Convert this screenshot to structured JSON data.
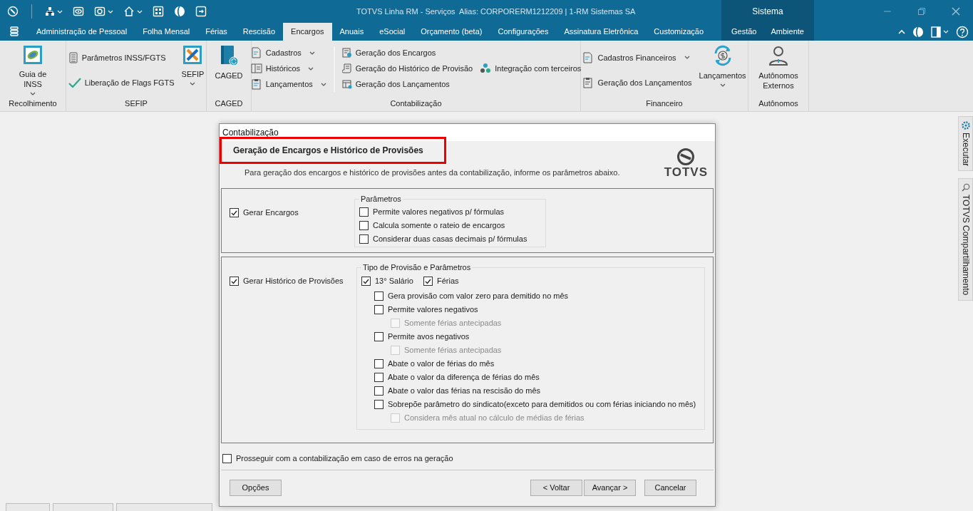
{
  "window": {
    "title": "TOTVS Linha RM - Serviços  Alias: CORPORERM1212209 | 1-RM Sistemas SA"
  },
  "ribbon_tabs": [
    {
      "label": "Administração de Pessoal",
      "selected": false
    },
    {
      "label": "Folha Mensal",
      "selected": false
    },
    {
      "label": "Férias",
      "selected": false
    },
    {
      "label": "Rescisão",
      "selected": false
    },
    {
      "label": "Encargos",
      "selected": true
    },
    {
      "label": "Anuais",
      "selected": false
    },
    {
      "label": "eSocial",
      "selected": false
    },
    {
      "label": "Orçamento (beta)",
      "selected": false
    },
    {
      "label": "Configurações",
      "selected": false
    },
    {
      "label": "Assinatura Eletrônica",
      "selected": false
    },
    {
      "label": "Customização",
      "selected": false
    }
  ],
  "context_group": {
    "label": "Sistema",
    "tabs": [
      {
        "label": "Gestão",
        "selected": false
      },
      {
        "label": "Ambiente",
        "selected": false
      }
    ]
  },
  "ribbon_groups": [
    {
      "label": "Recolhimento",
      "items": [
        {
          "kind": "large",
          "label": "Guia de INSS",
          "dropdown": true
        }
      ]
    },
    {
      "label": "SEFIP",
      "items": [
        {
          "kind": "stack",
          "items": [
            {
              "label": "Parâmetros INSS/FGTS",
              "dropdown": false
            },
            {
              "label": "Liberação de Flags FGTS",
              "dropdown": false
            }
          ]
        },
        {
          "kind": "large",
          "label": "SEFIP",
          "dropdown": true
        }
      ]
    },
    {
      "label": "CAGED",
      "items": [
        {
          "kind": "large",
          "label": "CAGED",
          "dropdown": false
        }
      ]
    },
    {
      "label": "Contabilização",
      "items": [
        {
          "kind": "stack",
          "separator": true,
          "items": [
            {
              "label": "Cadastros",
              "dropdown": true
            },
            {
              "label": "Históricos",
              "dropdown": true
            },
            {
              "label": "Lançamentos",
              "dropdown": true
            }
          ]
        },
        {
          "kind": "stack",
          "items": [
            {
              "label": "Geração dos Encargos",
              "dropdown": false
            },
            {
              "label": "Geração do Histórico de Provisão",
              "dropdown": false
            },
            {
              "label": "Geração dos Lançamentos",
              "dropdown": false
            }
          ]
        },
        {
          "kind": "stack",
          "items": [
            {
              "label": "Integração com terceiros",
              "dropdown": false
            }
          ]
        }
      ]
    },
    {
      "label": "Financeiro",
      "items": [
        {
          "kind": "stack",
          "items": [
            {
              "label": "Cadastros Financeiros",
              "dropdown": true
            },
            {
              "label": "Geração dos Lançamentos",
              "dropdown": false
            }
          ]
        },
        {
          "kind": "large",
          "label": "Lançamentos",
          "dropdown": true
        }
      ]
    },
    {
      "label": "Autônomos",
      "items": [
        {
          "kind": "large",
          "label": "Autônomos Externos",
          "dropdown": false
        }
      ]
    }
  ],
  "side_tabs": [
    "Executar",
    "TOTVS Compartilhamento"
  ],
  "dialog": {
    "title": "Contabilização",
    "heading": "Geração de Encargos e Histórico de Provisões",
    "heading_highlighted": true,
    "description": "Para geração dos encargos e histórico de provisões antes da contabilização, informe os parâmetros abaixo.",
    "logo": "TOTVS",
    "sections": [
      {
        "checkbox": {
          "label": "Gerar Encargos",
          "checked": true
        },
        "group": {
          "title": "Parâmetros",
          "options": [
            {
              "label": "Permite valores negativos p/ fórmulas",
              "checked": false,
              "disabled": false
            },
            {
              "label": "Calcula somente o rateio de encargos",
              "checked": false,
              "disabled": false
            },
            {
              "label": "Considerar duas casas decimais p/ fórmulas",
              "checked": false,
              "disabled": false
            }
          ]
        }
      },
      {
        "checkbox": {
          "label": "Gerar Histórico de Provisões",
          "checked": true
        },
        "group": {
          "title": "Tipo de Provisão e Parâmetros",
          "types": [
            {
              "label": "13° Salário",
              "checked": true
            },
            {
              "label": "Férias",
              "checked": true
            }
          ],
          "options": [
            {
              "label": "Gera provisão com valor zero para demitido no mês",
              "checked": false,
              "disabled": false
            },
            {
              "label": "Permite valores negativos",
              "checked": false,
              "disabled": false,
              "children": [
                {
                  "label": "Somente férias antecipadas",
                  "checked": false,
                  "disabled": true
                }
              ]
            },
            {
              "label": "Permite avos negativos",
              "checked": false,
              "disabled": false,
              "children": [
                {
                  "label": "Somente férias antecipadas",
                  "checked": false,
                  "disabled": true
                }
              ]
            },
            {
              "label": "Abate o valor de férias do mês",
              "checked": false,
              "disabled": false
            },
            {
              "label": "Abate o valor da diferença de férias do mês",
              "checked": false,
              "disabled": false
            },
            {
              "label": "Abate o valor das férias na rescisão do mês",
              "checked": false,
              "disabled": false
            },
            {
              "label": "Sobrepõe parâmetro do sindicato(exceto para demitidos ou com férias iniciando no mês)",
              "checked": false,
              "disabled": false,
              "children": [
                {
                  "label": "Considera mês atual no cálculo de médias de férias",
                  "checked": false,
                  "disabled": true
                }
              ]
            }
          ]
        }
      }
    ],
    "footer_checkbox": {
      "label": "Prosseguir com a contabilização em caso de erros na geração",
      "checked": false
    },
    "buttons": [
      {
        "label": "Opções",
        "kind": "left"
      },
      {
        "label": "< Voltar",
        "kind": "right"
      },
      {
        "label": "Avançar >",
        "kind": "right"
      },
      {
        "label": "Cancelar",
        "kind": "right"
      }
    ]
  }
}
